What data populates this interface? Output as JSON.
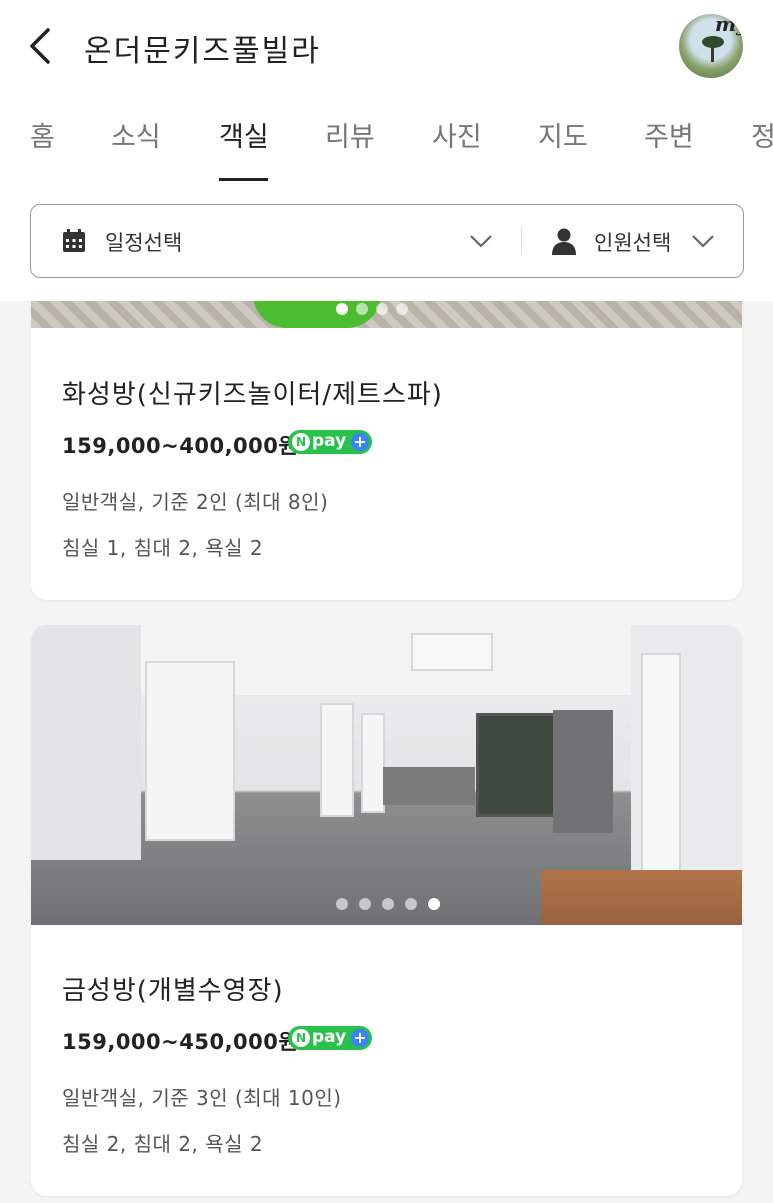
{
  "header": {
    "title": "온더문키즈풀빌라",
    "avatar_text": "my"
  },
  "tabs": [
    {
      "label": "홈",
      "active": false
    },
    {
      "label": "소식",
      "active": false
    },
    {
      "label": "객실",
      "active": true
    },
    {
      "label": "리뷰",
      "active": false
    },
    {
      "label": "사진",
      "active": false
    },
    {
      "label": "지도",
      "active": false
    },
    {
      "label": "주변",
      "active": false
    },
    {
      "label": "정",
      "active": false
    }
  ],
  "filter": {
    "date_label": "일정선택",
    "guest_label": "인원선택"
  },
  "rooms": [
    {
      "name": "화성방(신규키즈놀이터/제트스파)",
      "price": "159,000~400,000원",
      "npay_label": "pay",
      "info1": "일반객실, 기준 2인 (최대 8인)",
      "info2": "침실 1, 침대 2, 욕실 2",
      "photo_count": 4,
      "photo_active": 1
    },
    {
      "name": "금성방(개별수영장)",
      "price": "159,000~450,000원",
      "npay_label": "pay",
      "info1": "일반객실, 기준 3인 (최대 10인)",
      "info2": "침실 2, 침대 2, 욕실 2",
      "photo_count": 5,
      "photo_active": 5
    }
  ],
  "colors": {
    "npay_green": "#27c14b",
    "npay_plus_blue": "#3a82f6",
    "active_tab": "#222222",
    "inactive_tab": "#777777"
  }
}
